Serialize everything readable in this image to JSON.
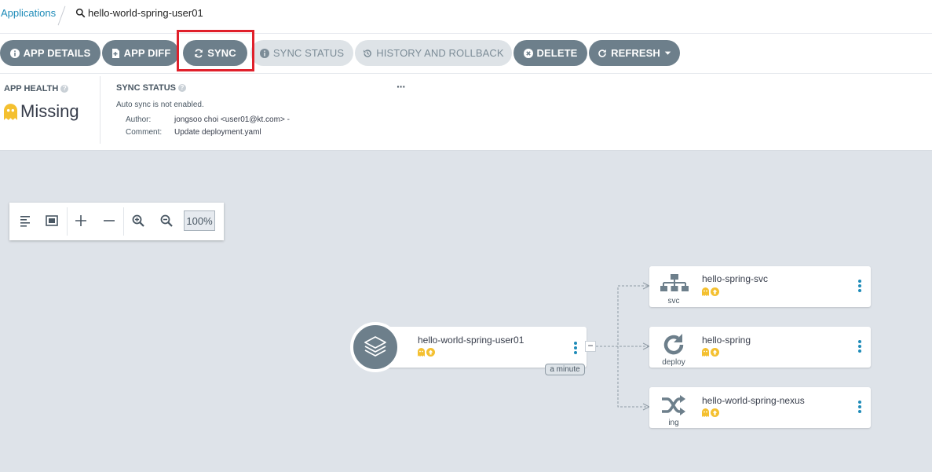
{
  "breadcrumb": {
    "link": "Applications",
    "current": "hello-world-spring-user01"
  },
  "toolbar": {
    "app_details": "APP DETAILS",
    "app_diff": "APP DIFF",
    "sync": "SYNC",
    "sync_status": "SYNC STATUS",
    "history": "HISTORY AND ROLLBACK",
    "delete": "DELETE",
    "refresh": "REFRESH"
  },
  "health": {
    "title": "APP HEALTH",
    "value": "Missing"
  },
  "sync": {
    "title": "SYNC STATUS",
    "auto": "Auto sync is not enabled.",
    "author_label": "Author:",
    "author": "jongsoo choi <user01@kt.com> -",
    "comment_label": "Comment:",
    "comment": "Update deployment.yaml",
    "more": "···"
  },
  "zoom": {
    "level": "100%"
  },
  "graph": {
    "app": {
      "name": "hello-world-spring-user01",
      "age": "a minute",
      "collapse": "−"
    },
    "resources": [
      {
        "name": "hello-spring-svc",
        "kind": "svc",
        "icon": "sitemap-icon"
      },
      {
        "name": "hello-spring",
        "kind": "deploy",
        "icon": "refresh-icon"
      },
      {
        "name": "hello-world-spring-nexus",
        "kind": "ing",
        "icon": "shuffle-icon"
      }
    ]
  },
  "colors": {
    "accent": "#1e8bb8",
    "button_dark": "#6d7f8b",
    "missing": "#f4c030",
    "canvas": "#dee3e9",
    "highlight": "#e0202b"
  }
}
